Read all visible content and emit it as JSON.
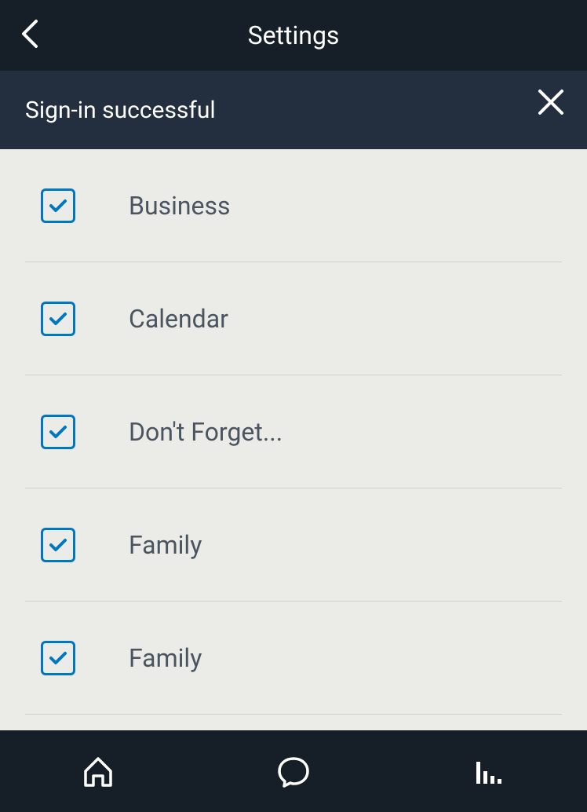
{
  "header": {
    "title": "Settings"
  },
  "notification": {
    "message": "Sign-in successful"
  },
  "items": [
    {
      "label": "Business",
      "checked": true
    },
    {
      "label": "Calendar",
      "checked": true
    },
    {
      "label": "Don't Forget...",
      "checked": true
    },
    {
      "label": "Family",
      "checked": true
    },
    {
      "label": "Family",
      "checked": true
    }
  ]
}
